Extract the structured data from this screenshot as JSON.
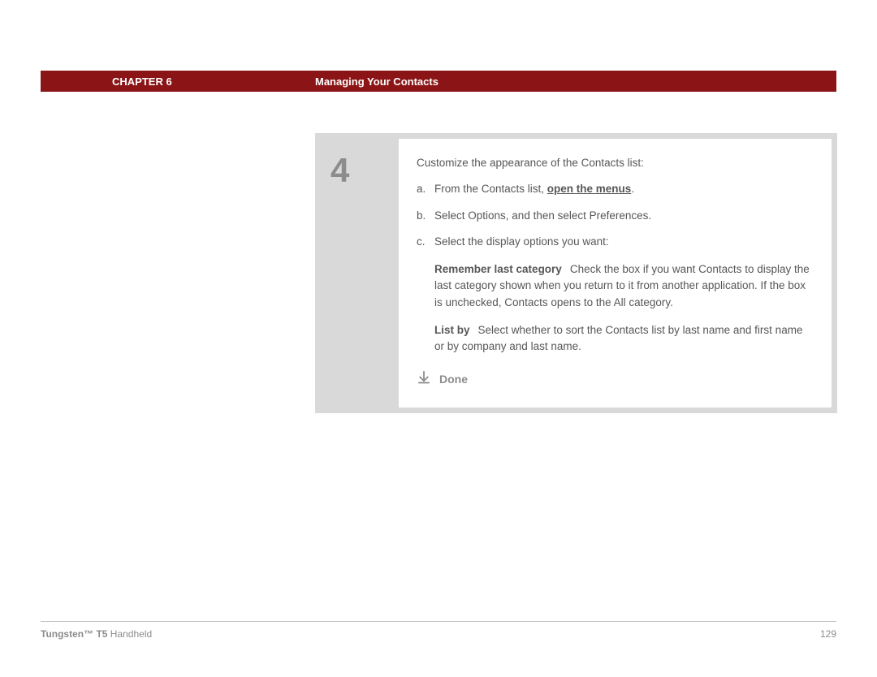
{
  "header": {
    "chapter": "CHAPTER 6",
    "title": "Managing Your Contacts"
  },
  "step": {
    "number": "4",
    "intro": "Customize the appearance of the Contacts list:",
    "items": [
      {
        "marker": "a.",
        "pre": "From the Contacts list, ",
        "link": "open the menus",
        "post": "."
      },
      {
        "marker": "b.",
        "text": "Select Options, and then select Preferences."
      },
      {
        "marker": "c.",
        "text": "Select the display options you want:"
      }
    ],
    "options": [
      {
        "lead": "Remember last category",
        "body": "Check the box if you want Contacts to display the last category shown when you return to it from another application. If the box is unchecked, Contacts opens to the All category."
      },
      {
        "lead": "List by",
        "body": "Select whether to sort the Contacts list by last name and first name or by company and last name."
      }
    ],
    "done": "Done"
  },
  "footer": {
    "product_bold": "Tungsten™ T5",
    "product_rest": " Handheld",
    "page": "129"
  }
}
